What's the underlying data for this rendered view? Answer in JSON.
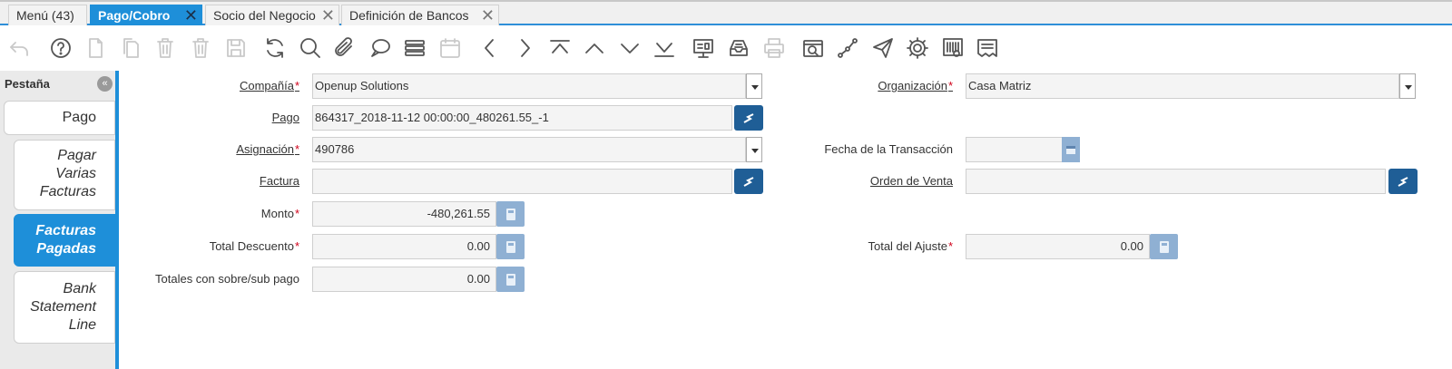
{
  "tabs": [
    {
      "label": "Menú (43)"
    },
    {
      "label": "Pago/Cobro"
    },
    {
      "label": "Socio del Negocio"
    },
    {
      "label": "Definición de Bancos"
    }
  ],
  "toolbar_icons": [
    "undo-icon",
    "help-icon",
    "new-record-icon",
    "copy-icon",
    "delete-icon",
    "delete-selection-icon",
    "save-icon",
    "refresh-icon",
    "find-icon",
    "attachment-icon",
    "chat-icon",
    "grid-toggle-icon",
    "calendar-icon",
    "previous-record-icon",
    "next-record-icon",
    "first-record-icon",
    "parent-record-icon",
    "detail-record-icon",
    "last-record-icon",
    "report-icon",
    "archive-icon",
    "print-icon",
    "zoom-across-icon",
    "workflow-icon",
    "send-icon",
    "process-icon",
    "product-info-icon",
    "post-icon"
  ],
  "sidebar": {
    "title": "Pestaña",
    "collapse": "«",
    "items": [
      {
        "label": "Pago"
      },
      {
        "label": "Pagar Varias Facturas"
      },
      {
        "label": "Facturas Pagadas"
      },
      {
        "label": "Bank Statement Line"
      }
    ]
  },
  "form": {
    "compania": {
      "label": "Compañía",
      "value": "Openup Solutions"
    },
    "organizacion": {
      "label": "Organización",
      "value": "Casa Matriz"
    },
    "pago": {
      "label": "Pago",
      "value": "864317_2018-11-12 00:00:00_480261.55_-1"
    },
    "asignacion": {
      "label": "Asignación",
      "value": "490786"
    },
    "fecha_transaccion": {
      "label": "Fecha de la Transacción",
      "value": ""
    },
    "factura": {
      "label": "Factura",
      "value": ""
    },
    "orden_venta": {
      "label": "Orden de Venta",
      "value": ""
    },
    "monto": {
      "label": "Monto",
      "value": "-480,261.55"
    },
    "total_descuento": {
      "label": "Total Descuento",
      "value": "0.00"
    },
    "total_ajuste": {
      "label": "Total del Ajuste",
      "value": "0.00"
    },
    "totales_sobre_sub": {
      "label": "Totales con sobre/sub pago",
      "value": "0.00"
    },
    "required_mark": "*"
  },
  "colors": {
    "accent": "#1e8fd9",
    "button": "#1f5e96",
    "required": "#d0021b"
  }
}
